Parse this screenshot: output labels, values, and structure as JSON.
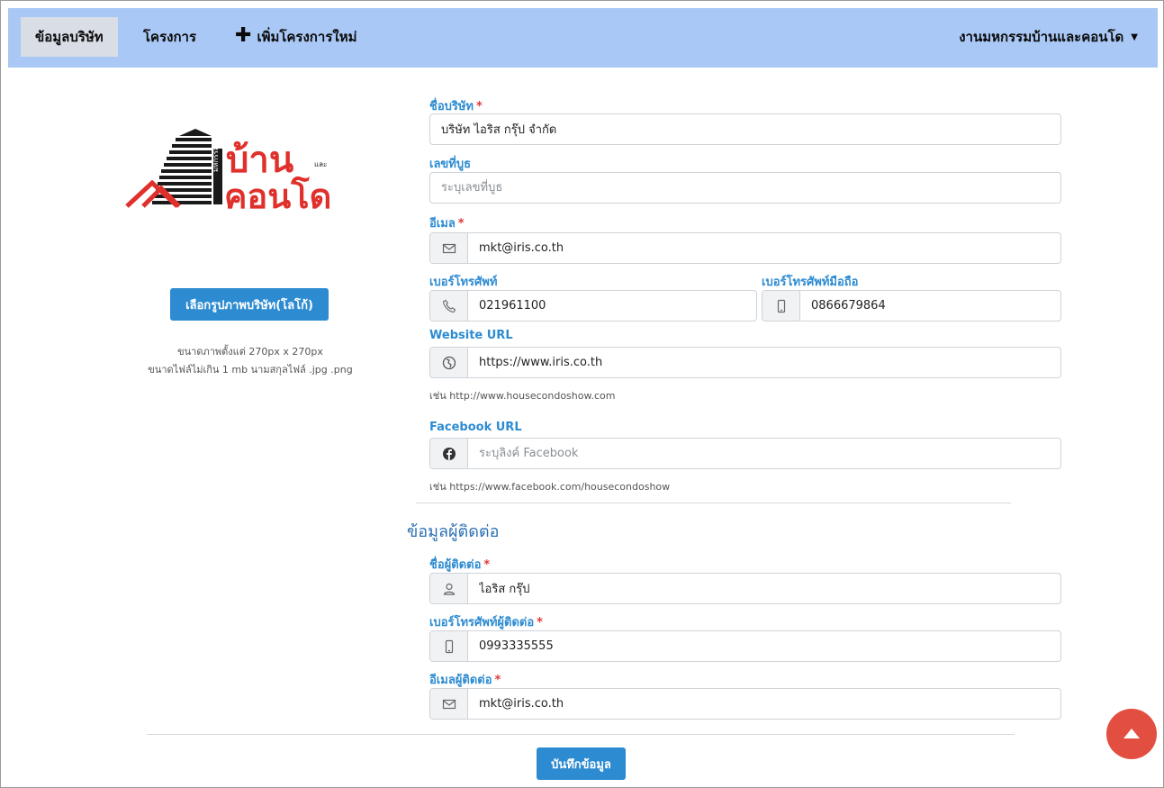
{
  "nav": {
    "company_info": "ข้อมูลบริษัท",
    "projects": "โครงการ",
    "add_project": "เพิ่มโครงการใหม่",
    "user_menu": "งานมหกรรมบ้านและคอนโด"
  },
  "logo": {
    "text_top": "บ้าน",
    "text_bottom": "คอนโด",
    "vertical_text": "มหกรรม",
    "small_text": "และ",
    "colors": {
      "red": "#e0302c",
      "black": "#1a1a1a"
    }
  },
  "upload": {
    "button_label": "เลือกรูปภาพบริษัท(โลโก้)",
    "hint_size": "ขนาดภาพตั้งแต่ 270px x 270px",
    "hint_file": "ขนาดไฟล์ไม่เกิน 1 mb นามสกุลไฟล์ .jpg .png"
  },
  "form": {
    "company_name": {
      "label": "ชื่อบริษัท",
      "value": "บริษัท ไอริส กรุ๊ป จำกัด"
    },
    "booth_number": {
      "label": "เลขที่บูธ",
      "value": "",
      "placeholder": "ระบุเลขที่บูธ"
    },
    "email": {
      "label": "อีเมล",
      "value": "mkt@iris.co.th",
      "icon": "mail-icon"
    },
    "phone": {
      "label": "เบอร์โทรศัพท์",
      "value": "021961100",
      "icon": "phone-icon"
    },
    "mobile": {
      "label": "เบอร์โทรศัพท์มือถือ",
      "value": "0866679864",
      "icon": "mobile-icon"
    },
    "website": {
      "label": "Website URL",
      "value": "https://www.iris.co.th",
      "icon": "globe-icon",
      "help": "เช่น http://www.housecondoshow.com"
    },
    "facebook": {
      "label": "Facebook URL",
      "value": "",
      "placeholder": "ระบุลิงค์ Facebook",
      "icon": "facebook-icon",
      "help": "เช่น https://www.facebook.com/housecondoshow"
    }
  },
  "contact": {
    "section_title": "ข้อมูลผู้ติดต่อ",
    "name": {
      "label": "ชื่อผู้ติดต่อ",
      "value": "ไอริส กรุ๊ป",
      "icon": "user-icon"
    },
    "phone": {
      "label": "เบอร์โทรศัพท์ผู้ติดต่อ",
      "value": "0993335555",
      "icon": "mobile-icon"
    },
    "email": {
      "label": "อีเมลผู้ติดต่อ",
      "value": "mkt@iris.co.th",
      "icon": "mail-icon"
    }
  },
  "required_mark": "*",
  "save_button": "บันทึกข้อมูล",
  "colors": {
    "nav_bg": "#a9c8f5",
    "accent": "#2d8bd1",
    "required": "#e03a3a",
    "scroll_top": "#e24e3f"
  }
}
